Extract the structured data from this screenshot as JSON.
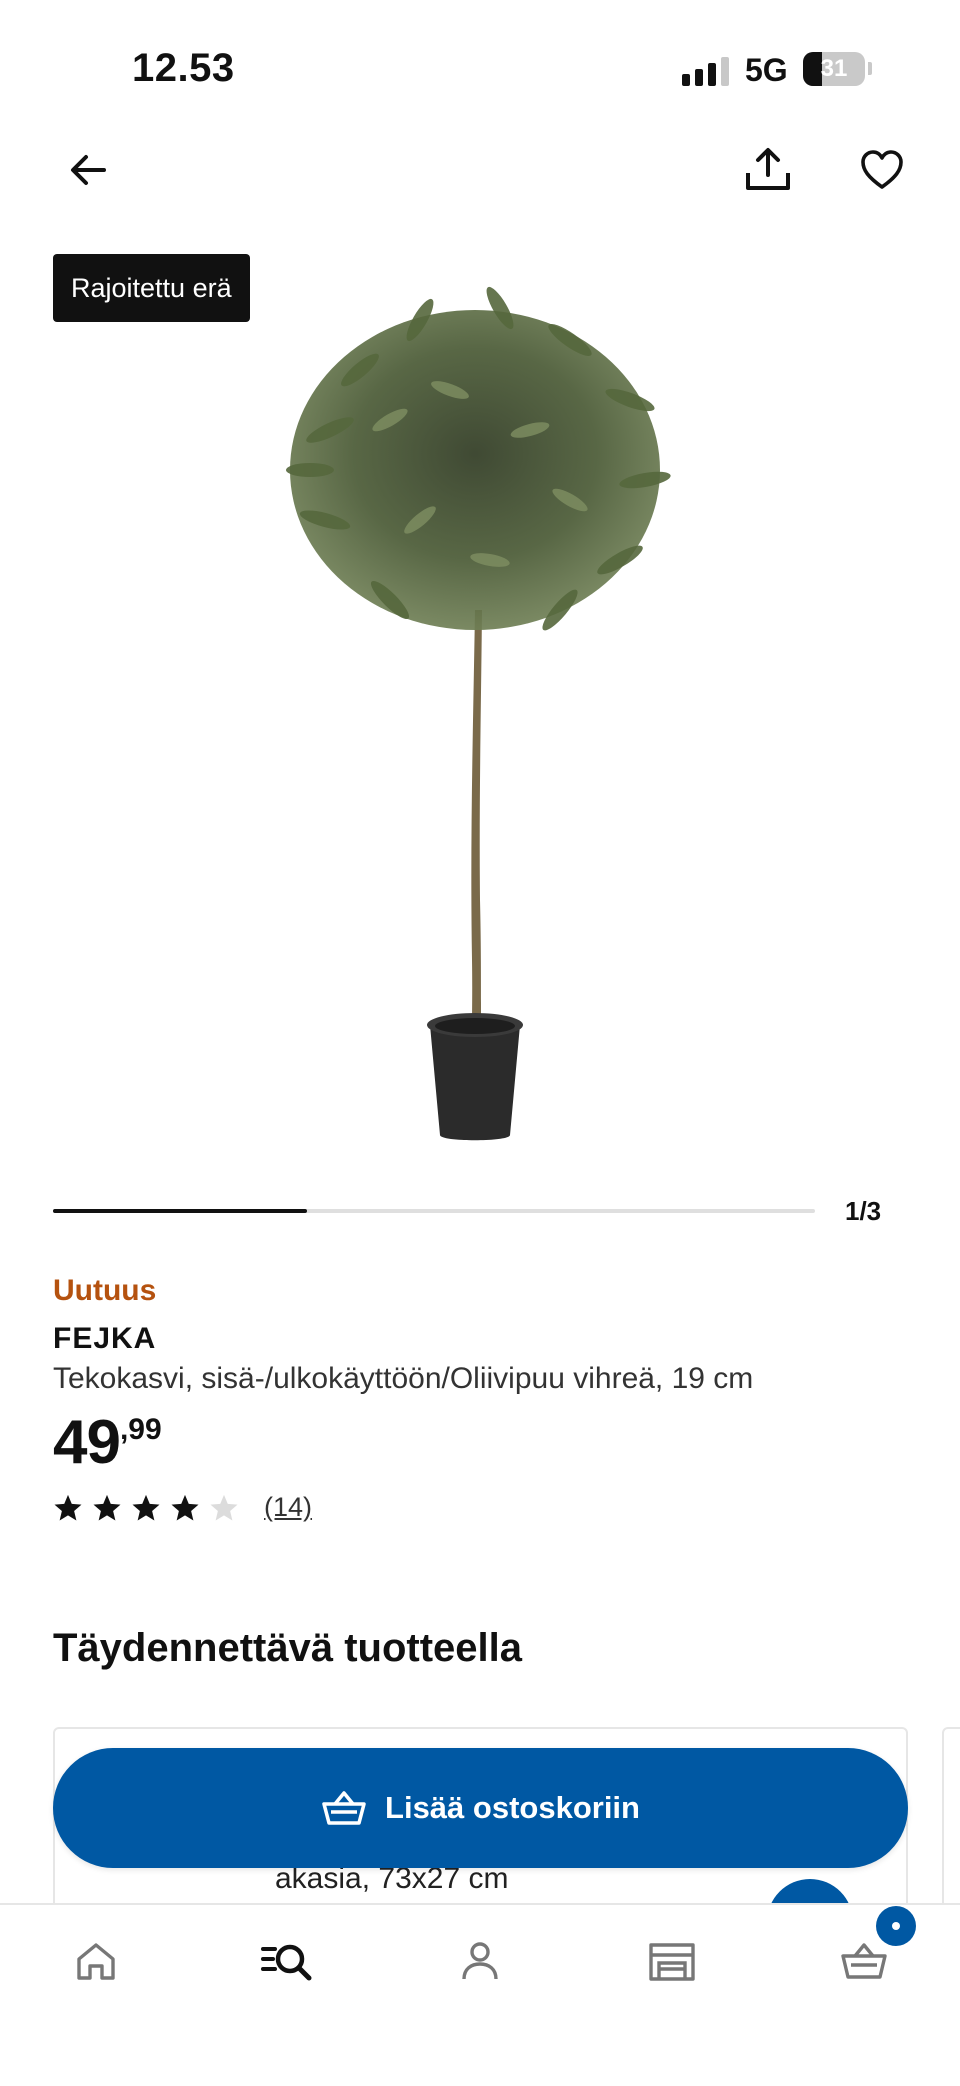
{
  "status_bar": {
    "time": "12.53",
    "network": "5G",
    "battery": "31",
    "battery_level_percent": 31
  },
  "icons": {
    "back": "arrow-left-icon",
    "share": "share-icon",
    "favourite": "heart-icon",
    "cart_add": "basket-plus-icon",
    "nav": [
      "home-icon",
      "search-list-icon",
      "person-icon",
      "store-icon",
      "basket-icon"
    ]
  },
  "product": {
    "badge": "Rajoitettu erä",
    "image_position": "1/3",
    "image_progress_fraction": 0.333,
    "new_label": "Uutuus",
    "name": "FEJKA",
    "description": "Tekokasvi, sisä-/ulkokäyttöön/Oliivipuu vihreä, 19 cm",
    "price_integer": "49",
    "price_decimal": ",99",
    "rating_stars": 4,
    "rating_max": 5,
    "review_count": "(14)"
  },
  "complement": {
    "title": "Täydennettävä tuotteella",
    "card_text": "akasia, 73x27 cm"
  },
  "cta": {
    "label": "Lisää ostoskoriin"
  },
  "colors": {
    "brand_blue": "#0058a3",
    "new_label": "#b5520f",
    "text": "#111111"
  }
}
